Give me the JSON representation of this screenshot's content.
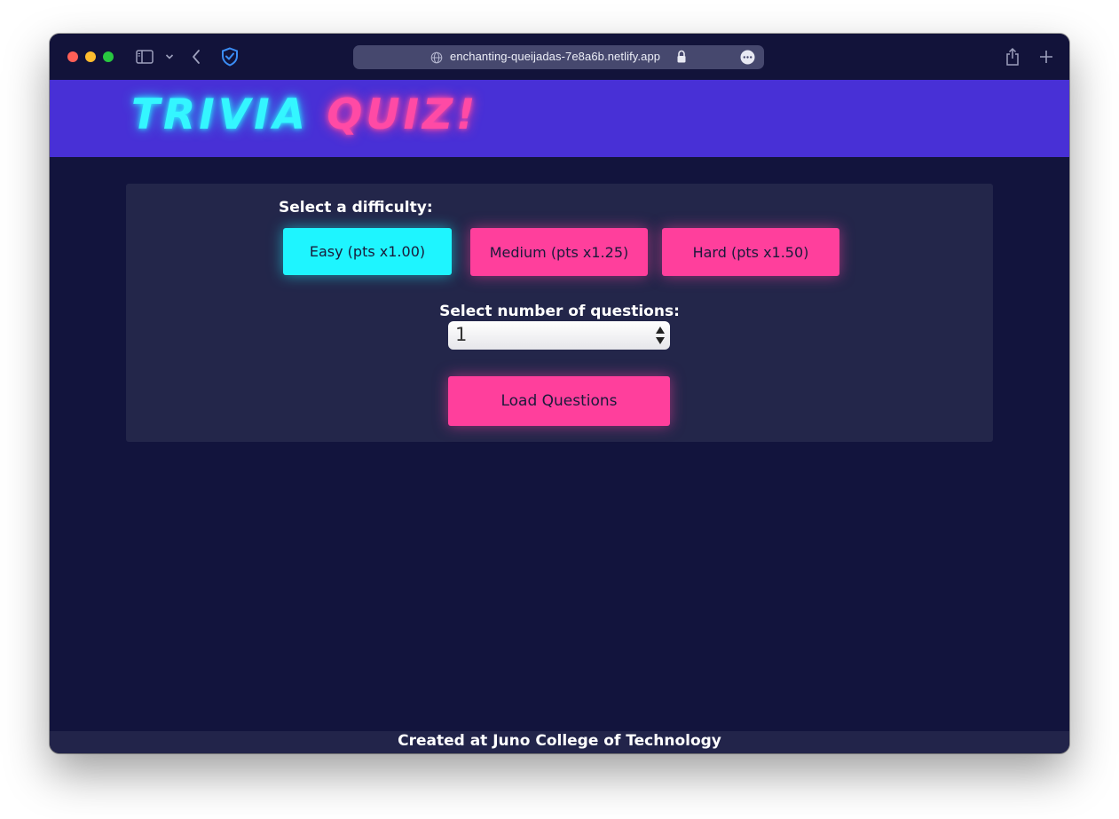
{
  "browser": {
    "url": "enchanting-queijadas-7e8a6b.netlify.app",
    "icons": [
      "sidebar-icon",
      "chevron-down-icon",
      "back-icon",
      "shield-icon",
      "globe-icon",
      "lock-icon",
      "more-icon",
      "share-icon",
      "plus-icon"
    ]
  },
  "header": {
    "logo_part1": "TRIVIA",
    "logo_part2": "QUIZ!"
  },
  "difficulty": {
    "label": "Select a difficulty:",
    "options": [
      {
        "label": "Easy (pts x1.00)",
        "color": "#1ef5ff",
        "selected": true
      },
      {
        "label": "Medium (pts x1.25)",
        "color": "#ff3f9c",
        "selected": false
      },
      {
        "label": "Hard (pts x1.50)",
        "color": "#ff3f9c",
        "selected": false
      }
    ]
  },
  "questions": {
    "label": "Select number of questions:",
    "value": "1"
  },
  "load_button": "Load Questions",
  "footer": {
    "text": "Created at Juno College of Technology"
  },
  "colors": {
    "page_bg": "#12143d",
    "header_bg": "#4830d6",
    "panel_bg": "#23264a",
    "accent_cyan": "#1ef5ff",
    "accent_pink": "#ff3f9c"
  }
}
